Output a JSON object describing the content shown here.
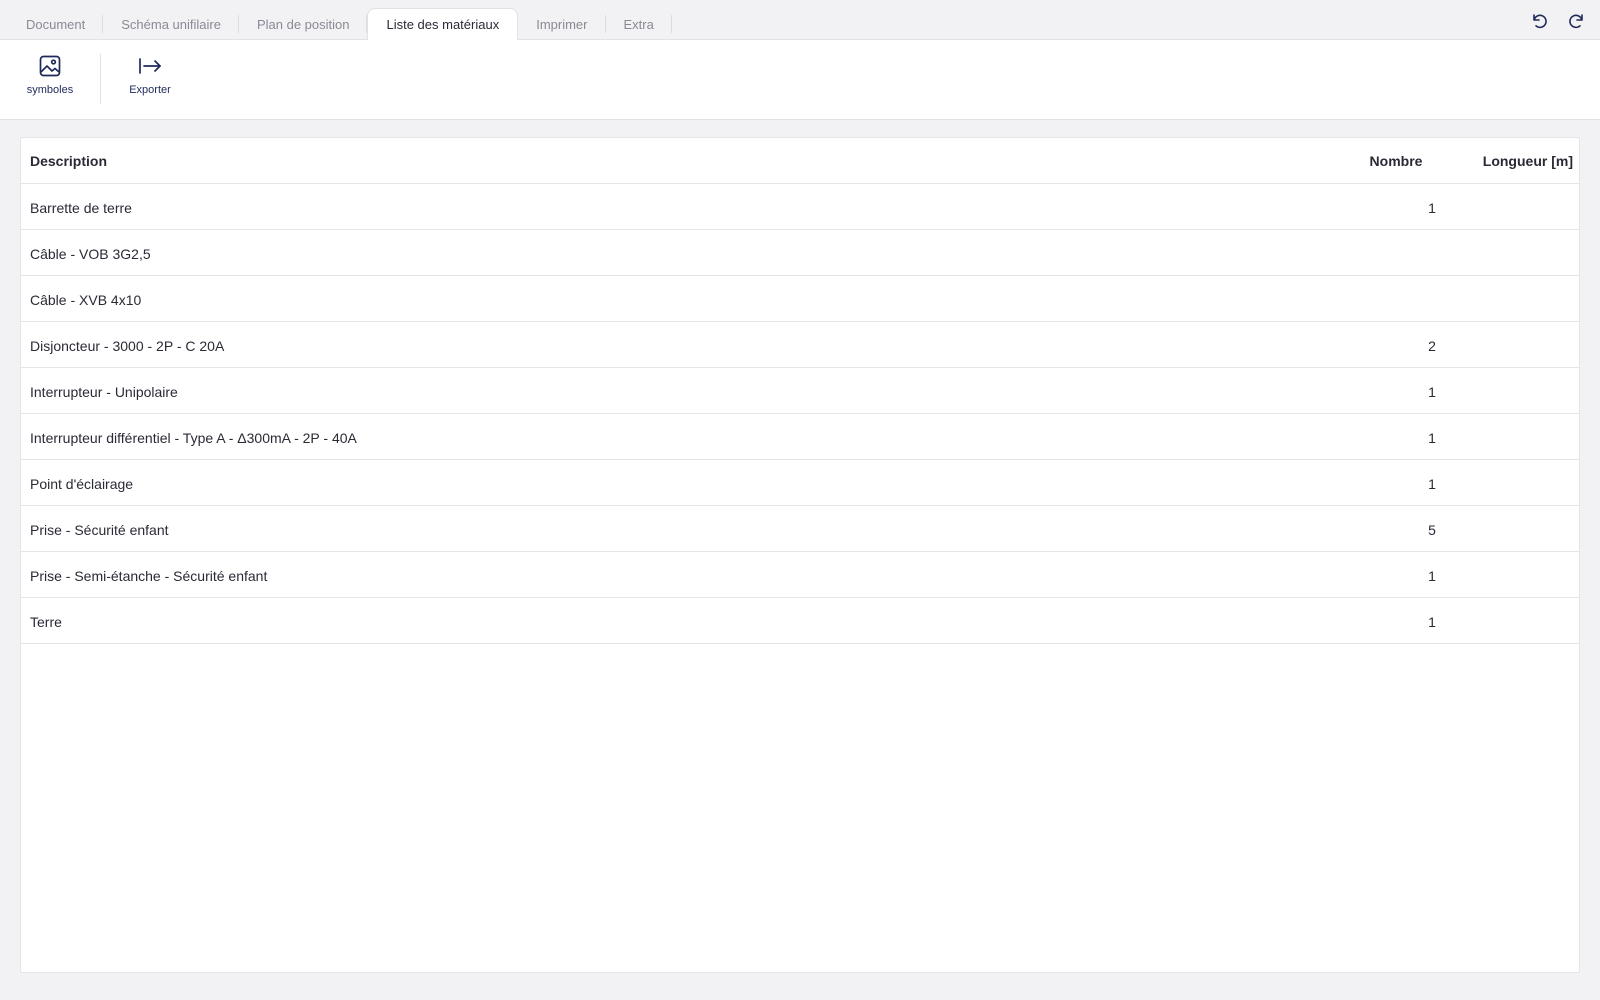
{
  "tabs": [
    {
      "label": "Document",
      "active": false
    },
    {
      "label": "Schéma unifilaire",
      "active": false
    },
    {
      "label": "Plan de position",
      "active": false
    },
    {
      "label": "Liste des matériaux",
      "active": true
    },
    {
      "label": "Imprimer",
      "active": false
    },
    {
      "label": "Extra",
      "active": false
    }
  ],
  "history": {
    "undo_icon": "undo-icon",
    "redo_icon": "redo-icon"
  },
  "toolbar": {
    "symbols_label": "symboles",
    "symbols_icon": "image-icon",
    "export_label": "Exporter",
    "export_icon": "export-arrow-icon"
  },
  "table": {
    "headers": {
      "description": "Description",
      "count": "Nombre",
      "length": "Longueur [m]"
    },
    "rows": [
      {
        "description": "Barrette de terre",
        "count": "1",
        "length": ""
      },
      {
        "description": "Câble - VOB 3G2,5",
        "count": "",
        "length": ""
      },
      {
        "description": "Câble - XVB 4x10",
        "count": "",
        "length": ""
      },
      {
        "description": "Disjoncteur - 3000 - 2P - C 20A",
        "count": "2",
        "length": ""
      },
      {
        "description": "Interrupteur - Unipolaire",
        "count": "1",
        "length": ""
      },
      {
        "description": "Interrupteur différentiel - Type A - Δ300mA - 2P - 40A",
        "count": "1",
        "length": ""
      },
      {
        "description": "Point d'éclairage",
        "count": "1",
        "length": ""
      },
      {
        "description": "Prise - Sécurité enfant",
        "count": "5",
        "length": ""
      },
      {
        "description": "Prise - Semi-étanche - Sécurité enfant",
        "count": "1",
        "length": ""
      },
      {
        "description": "Terre",
        "count": "1",
        "length": ""
      }
    ]
  },
  "colors": {
    "accent": "#1f2a5a",
    "background": "#f2f2f4",
    "panel": "#ffffff",
    "border": "#e4e4e9"
  }
}
